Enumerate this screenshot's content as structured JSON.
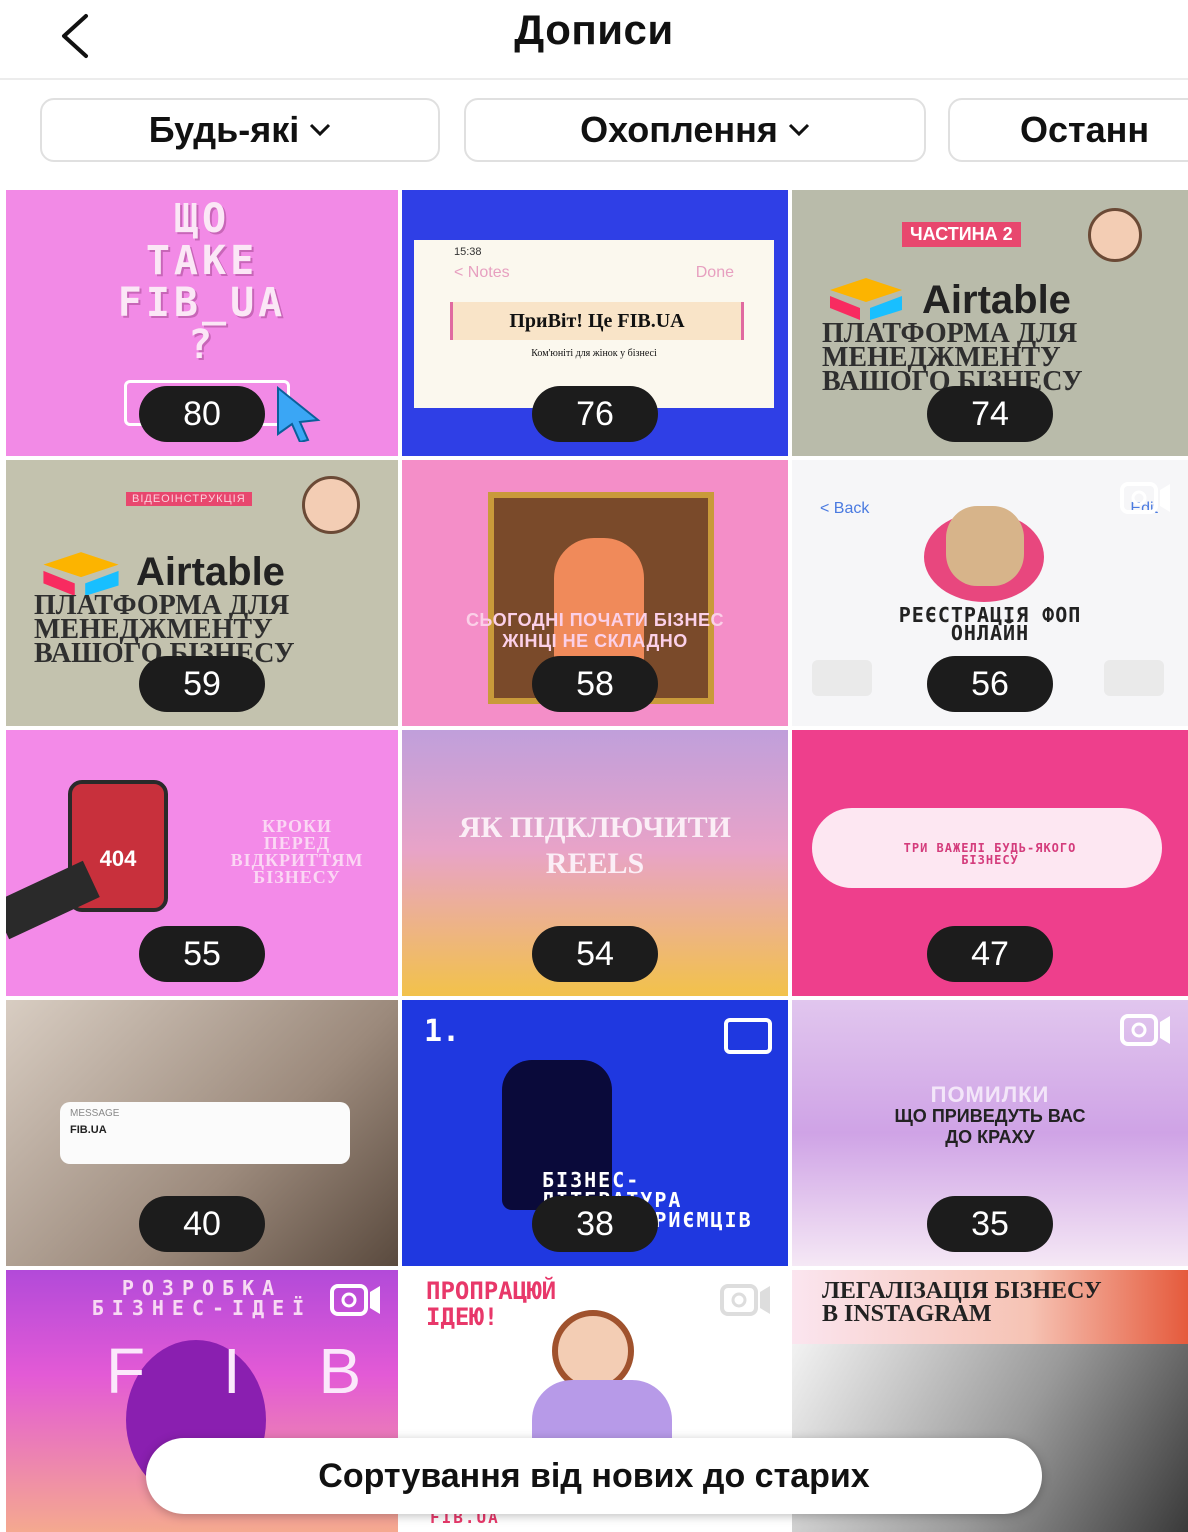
{
  "header": {
    "title": "Дописи",
    "back_icon": "chevron-left-icon"
  },
  "filters": [
    {
      "label": "Будь-які",
      "icon": "chevron-down-icon"
    },
    {
      "label": "Охоплення",
      "icon": "chevron-down-icon"
    },
    {
      "label": "Останн"
    }
  ],
  "posts": [
    {
      "count": "80",
      "caption": "ЩО\nТАКЕ\nFIB_UA\n?",
      "bg": "#f28ae6"
    },
    {
      "count": "76",
      "caption": "ПриВіт! Це FIB.UA",
      "note_header_left": "< Notes",
      "note_header_right": "Done",
      "note_time": "15:38",
      "note_sub": "Ком'юніті для жінок у бізнесі",
      "bg": "#2f3fe6"
    },
    {
      "count": "74",
      "tag": "ЧАСТИНА 2",
      "brand": "Airtable",
      "caption": "ПЛАТФОРМА ДЛЯ\nМЕНЕДЖМЕНТУ\nВАШОГО БІЗНЕСУ",
      "bg": "#b9bbaa"
    },
    {
      "count": "59",
      "tag": "ВІДЕОІНСТРУКЦІЯ",
      "brand": "Airtable",
      "caption": "ПЛАТФОРМА ДЛЯ\nМЕНЕДЖМЕНТУ\nВАШОГО БІЗНЕСУ",
      "bg": "#c3c2ae"
    },
    {
      "count": "58",
      "caption": "СЬОГОДНІ ПОЧАТИ БІЗНЕС\nЖІНЦІ НЕ СКЛАДНО",
      "bg": "#f48ec8"
    },
    {
      "count": "56",
      "back": "< Back",
      "edit": "Edit",
      "caption": "РЕЄСТРАЦІЯ ФОП\nОНЛАЙН",
      "bg": "#f6f6f8"
    },
    {
      "count": "55",
      "caption": "КРОКИ\nПЕРЕД\nВІДКРИТТЯМ\nБІЗНЕСУ",
      "phone_text": "404",
      "bg": "#f38ae8"
    },
    {
      "count": "54",
      "caption": "ЯК ПІДКЛЮЧИТИ\nREELS",
      "bg": "#d7a4d6"
    },
    {
      "count": "47",
      "caption": "ТРИ ВАЖЕЛІ БУДЬ-ЯКОГО\nБІЗНЕСУ",
      "bg": "#ee3f8c"
    },
    {
      "count": "40",
      "notif_app": "MESSAGE",
      "notif_title": "FIB.UA",
      "bg": "#9c8a7c"
    },
    {
      "count": "38",
      "num": "1.",
      "caption": "БІЗНЕС-\nЛІТЕРАТУРА\nДЛЯ ПІДПРИЄМЦІВ",
      "bg": "#1f38e0"
    },
    {
      "count": "35",
      "caption_a": "ПОМИЛКИ",
      "caption_b": "ЩО ПРИВЕДУТЬ ВАС\nДО КРАХУ",
      "bg": "#d6b1e8"
    },
    {
      "count": "",
      "caption": "РОЗРОБКА\nБІЗНЕС-ІДЕЇ",
      "letters": "F I B",
      "bg": "#e35ad6"
    },
    {
      "count": "",
      "caption": "ПРОПРАЦЮЙ\nІДЕЮ!",
      "footer": "FIB.UA",
      "bg": "#ffffff"
    },
    {
      "count": "",
      "caption": "ЛЕГАЛІЗАЦІЯ БІЗНЕСУ\nВ INSTAGRAM",
      "bg": "#e55a3c"
    }
  ],
  "sort_label": "Сортування від нових до старих"
}
